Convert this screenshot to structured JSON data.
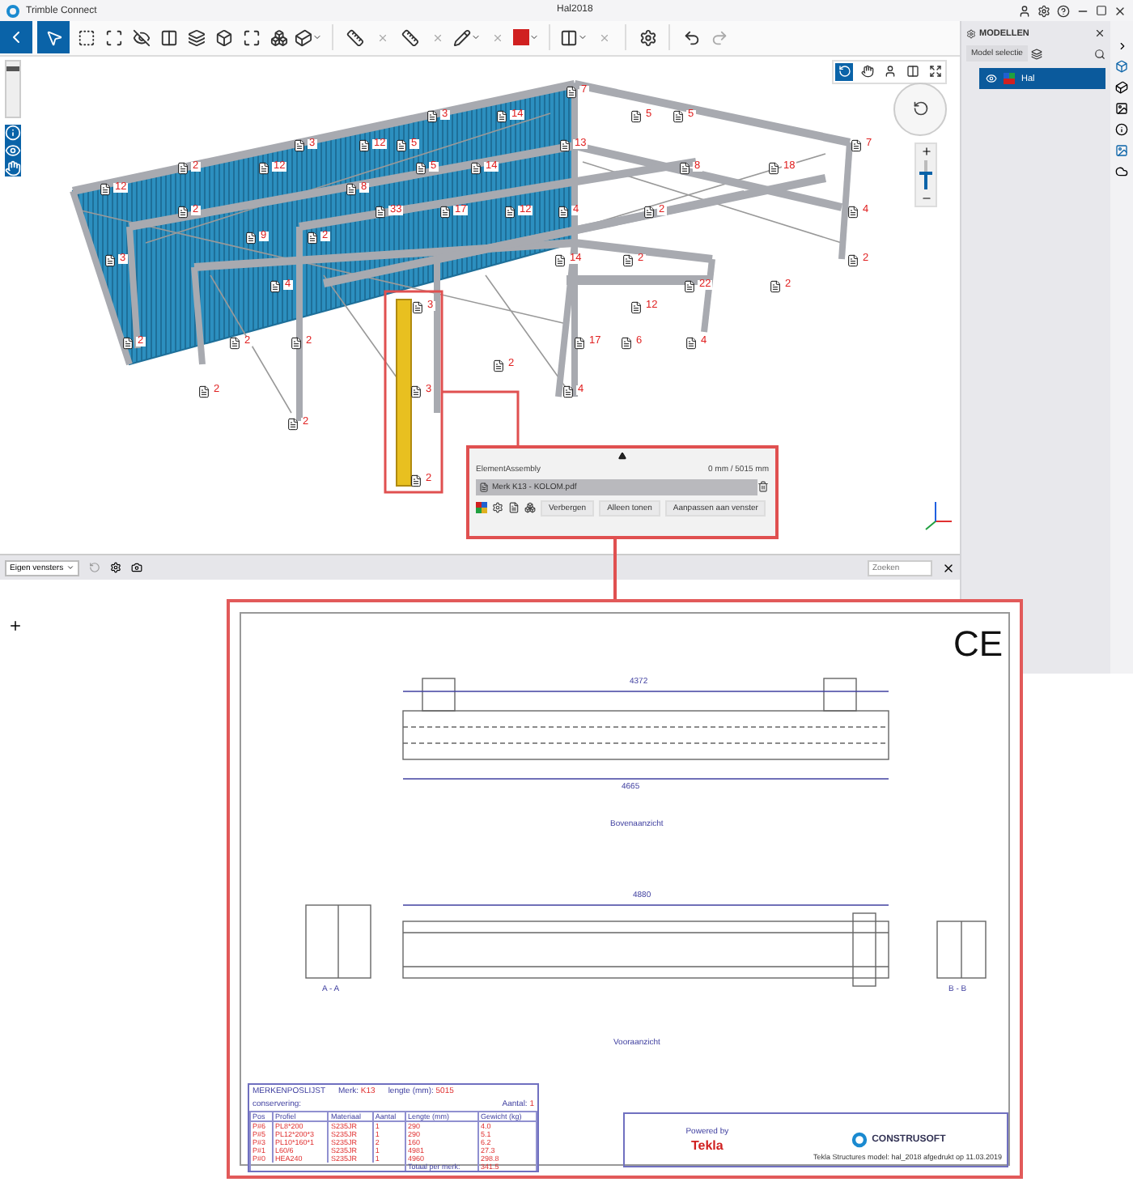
{
  "app": {
    "name": "Trimble Connect",
    "project": "Hal2018"
  },
  "viewport": {
    "clip_slider": {
      "level": 0.9
    },
    "zoom_slider": {
      "level": 0.55
    },
    "labels": [
      "7",
      "3",
      "14",
      "5",
      "5",
      "3",
      "12",
      "5",
      "13",
      "7",
      "2",
      "12",
      "5",
      "14",
      "8",
      "18",
      "12",
      "8",
      "2",
      "33",
      "17",
      "12",
      "4",
      "2",
      "4",
      "9",
      "2",
      "3",
      "14",
      "2",
      "2",
      "4",
      "22",
      "2",
      "3",
      "12",
      "2",
      "2",
      "2",
      "17",
      "6",
      "4",
      "2",
      "2",
      "3",
      "4",
      "2",
      "2"
    ]
  },
  "popup": {
    "type": "ElementAssembly",
    "measure": "0 mm / 5015 mm",
    "attachment": "Merk K13 - KOLOM.pdf",
    "buttons": [
      "Verbergen",
      "Alleen tonen",
      "Aanpassen aan venster"
    ]
  },
  "bottom_bar": {
    "view_select": "Eigen vensters",
    "search": {
      "placeholder": "Zoeken"
    }
  },
  "models_panel": {
    "title": "MODELLEN",
    "button": "Model selectie",
    "items": [
      {
        "name": "Hal",
        "selected": true
      }
    ]
  },
  "drawing": {
    "mark": "CE",
    "dims": [
      "4372",
      "4665",
      "4880"
    ],
    "views": [
      "Bovenaanzicht",
      "Vooraanzicht",
      "A - A",
      "B - B"
    ],
    "parts_list": {
      "title": "MERKENPOSLIJST",
      "mark_label": "Merk:",
      "mark": "K13",
      "length_label": "lengte (mm):",
      "length": "5015",
      "coating_label": "conservering:",
      "count_label": "Aantal:",
      "count": "1",
      "columns": [
        "Pos",
        "Profiel",
        "Materiaal",
        "Aantal",
        "Lengte (mm)",
        "Gewicht (kg)"
      ],
      "rows": [
        [
          "P#6",
          "PL8*200",
          "S235JR",
          "1",
          "290",
          "4.0"
        ],
        [
          "P#5",
          "PL12*200*3",
          "S235JR",
          "1",
          "290",
          "5.1"
        ],
        [
          "P#3",
          "PL10*160*1",
          "S235JR",
          "2",
          "160",
          "6.2"
        ],
        [
          "P#1",
          "L60/6",
          "S235JR",
          "1",
          "4981",
          "27.3"
        ],
        [
          "P#0",
          "HEA240",
          "S235JR",
          "1",
          "4960",
          "298.8"
        ]
      ],
      "total_label": "Totaal per merk:",
      "total": "341.5"
    },
    "powered_by": "Powered by",
    "tekla": "Tekla",
    "company": "CONSTRUSOFT",
    "footer": "Tekla Structures model: hal_2018 afgedrukt op 11.03.2019"
  }
}
